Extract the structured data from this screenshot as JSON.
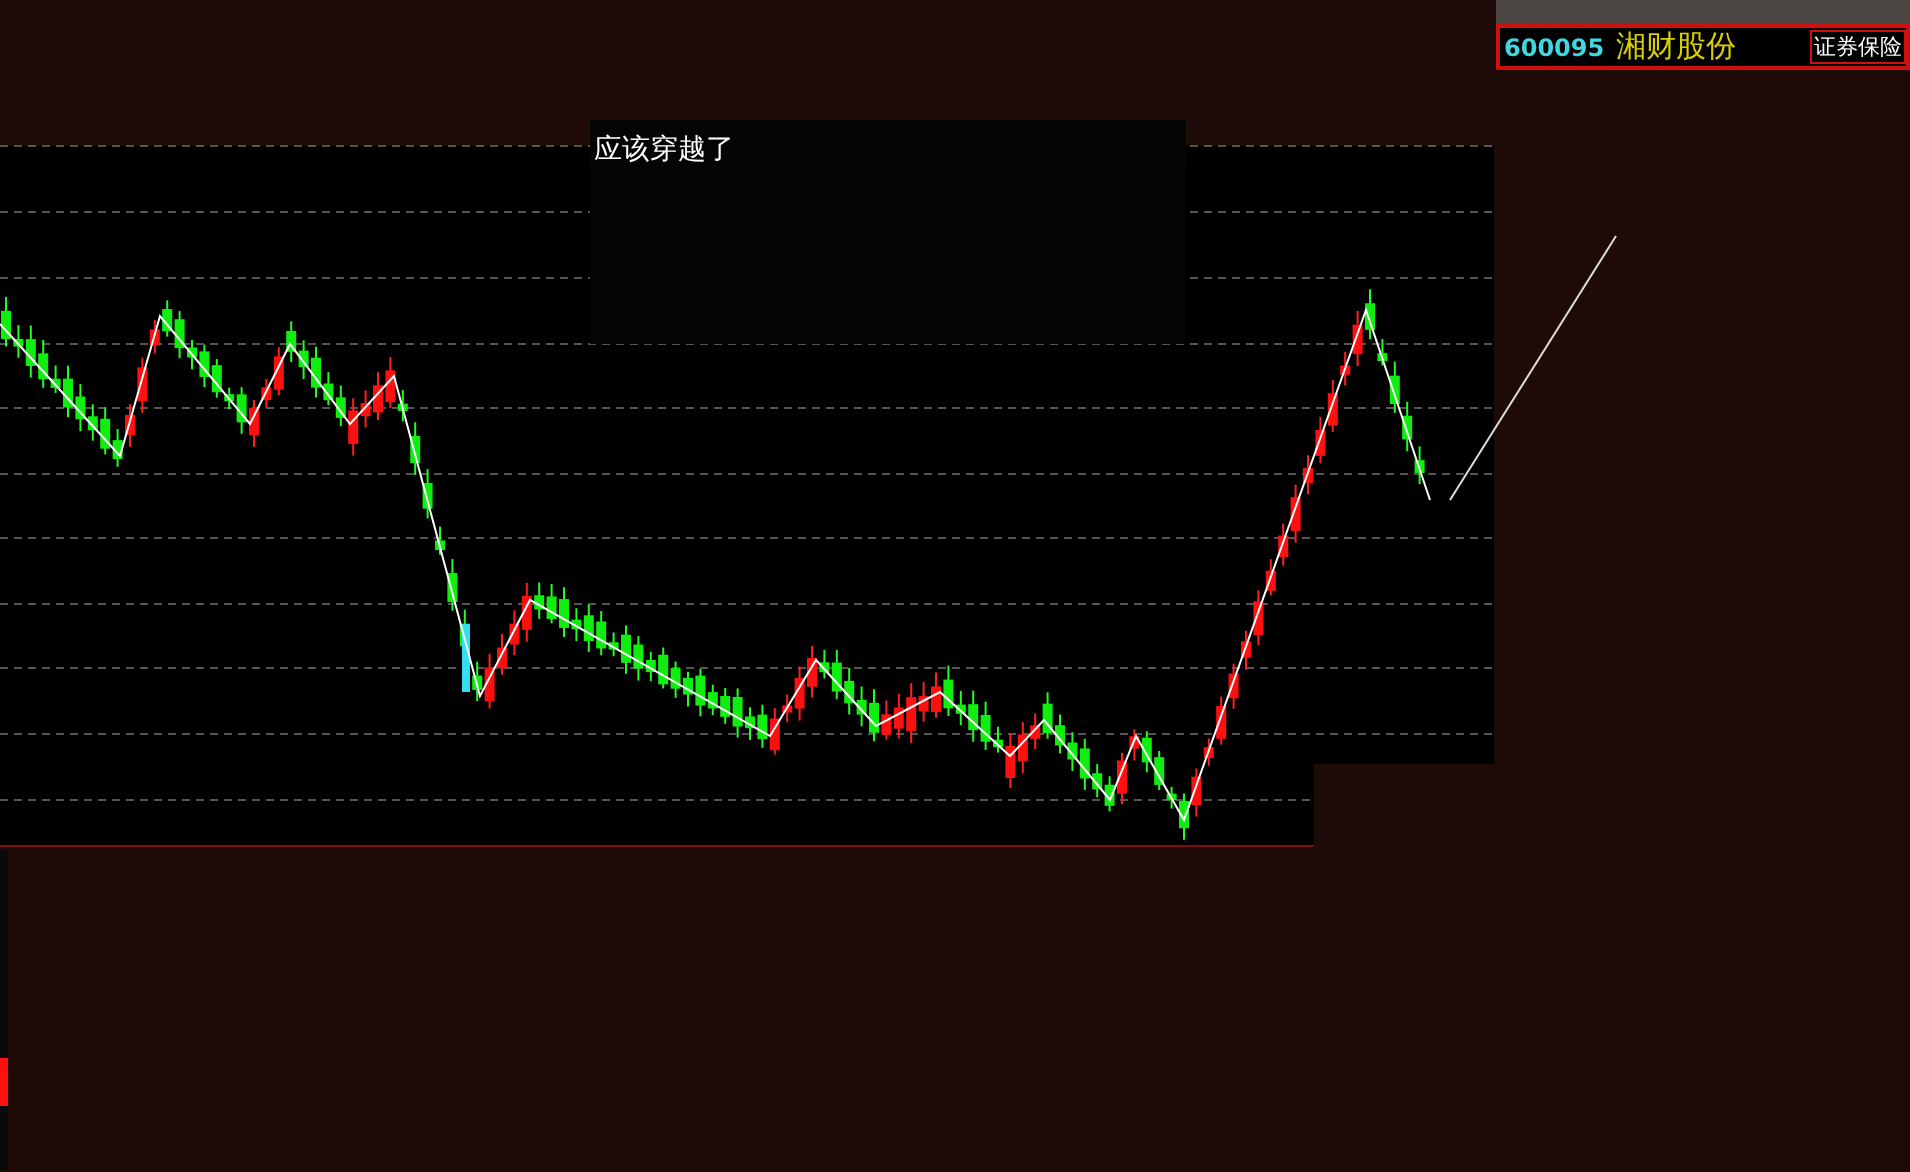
{
  "header": {
    "code": "600095",
    "name": "湘财股份",
    "sector_tag": "证券保险"
  },
  "annotation": {
    "text": "应该穿越了"
  }
}
